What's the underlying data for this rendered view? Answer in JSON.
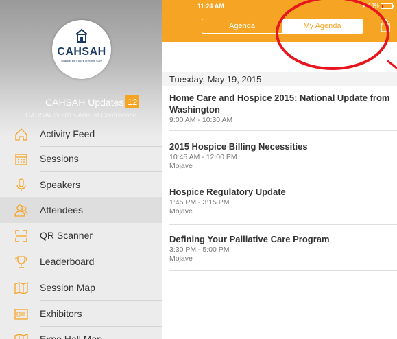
{
  "sidebar": {
    "logo_text": "CAHSAH",
    "logo_tagline": "Shaping the Future of Home Care",
    "title": "CAHSAH Updates",
    "badge": "12",
    "subtitle": "CAHSAH® 2015 Annual Conference",
    "items": [
      {
        "label": "Activity Feed",
        "icon": "home-icon"
      },
      {
        "label": "Sessions",
        "icon": "calendar-icon"
      },
      {
        "label": "Speakers",
        "icon": "microphone-icon"
      },
      {
        "label": "Attendees",
        "icon": "people-icon"
      },
      {
        "label": "QR Scanner",
        "icon": "qr-scanner-icon"
      },
      {
        "label": "Leaderboard",
        "icon": "trophy-icon"
      },
      {
        "label": "Session Map",
        "icon": "map-icon"
      },
      {
        "label": "Exhibitors",
        "icon": "exhibitors-icon"
      },
      {
        "label": "Expo Hall Map",
        "icon": "map-icon"
      }
    ]
  },
  "status_bar": {
    "time": "11:24 AM",
    "battery": "13%"
  },
  "tabs": {
    "agenda": "Agenda",
    "my_agenda": "My Agenda",
    "selected": "My Agenda"
  },
  "agenda": {
    "date": "Tuesday, May 19, 2015",
    "sessions": [
      {
        "title": "Home Care and Hospice 2015: National Update from Washington",
        "time": "9:00 AM - 10:30 AM",
        "room": ""
      },
      {
        "title": "2015 Hospice Billing Necessities",
        "time": "10:45 AM - 12:00 PM",
        "room": "Mojave"
      },
      {
        "title": "Hospice Regulatory Update",
        "time": "1:45 PM - 3:15 PM",
        "room": "Mojave"
      },
      {
        "title": "Defining Your Palliative Care Program",
        "time": "3:30 PM - 5:00 PM",
        "room": "Mojave"
      }
    ]
  },
  "colors": {
    "accent": "#f5a523",
    "annotation": "#e8141e",
    "logo": "#1d3a66"
  }
}
